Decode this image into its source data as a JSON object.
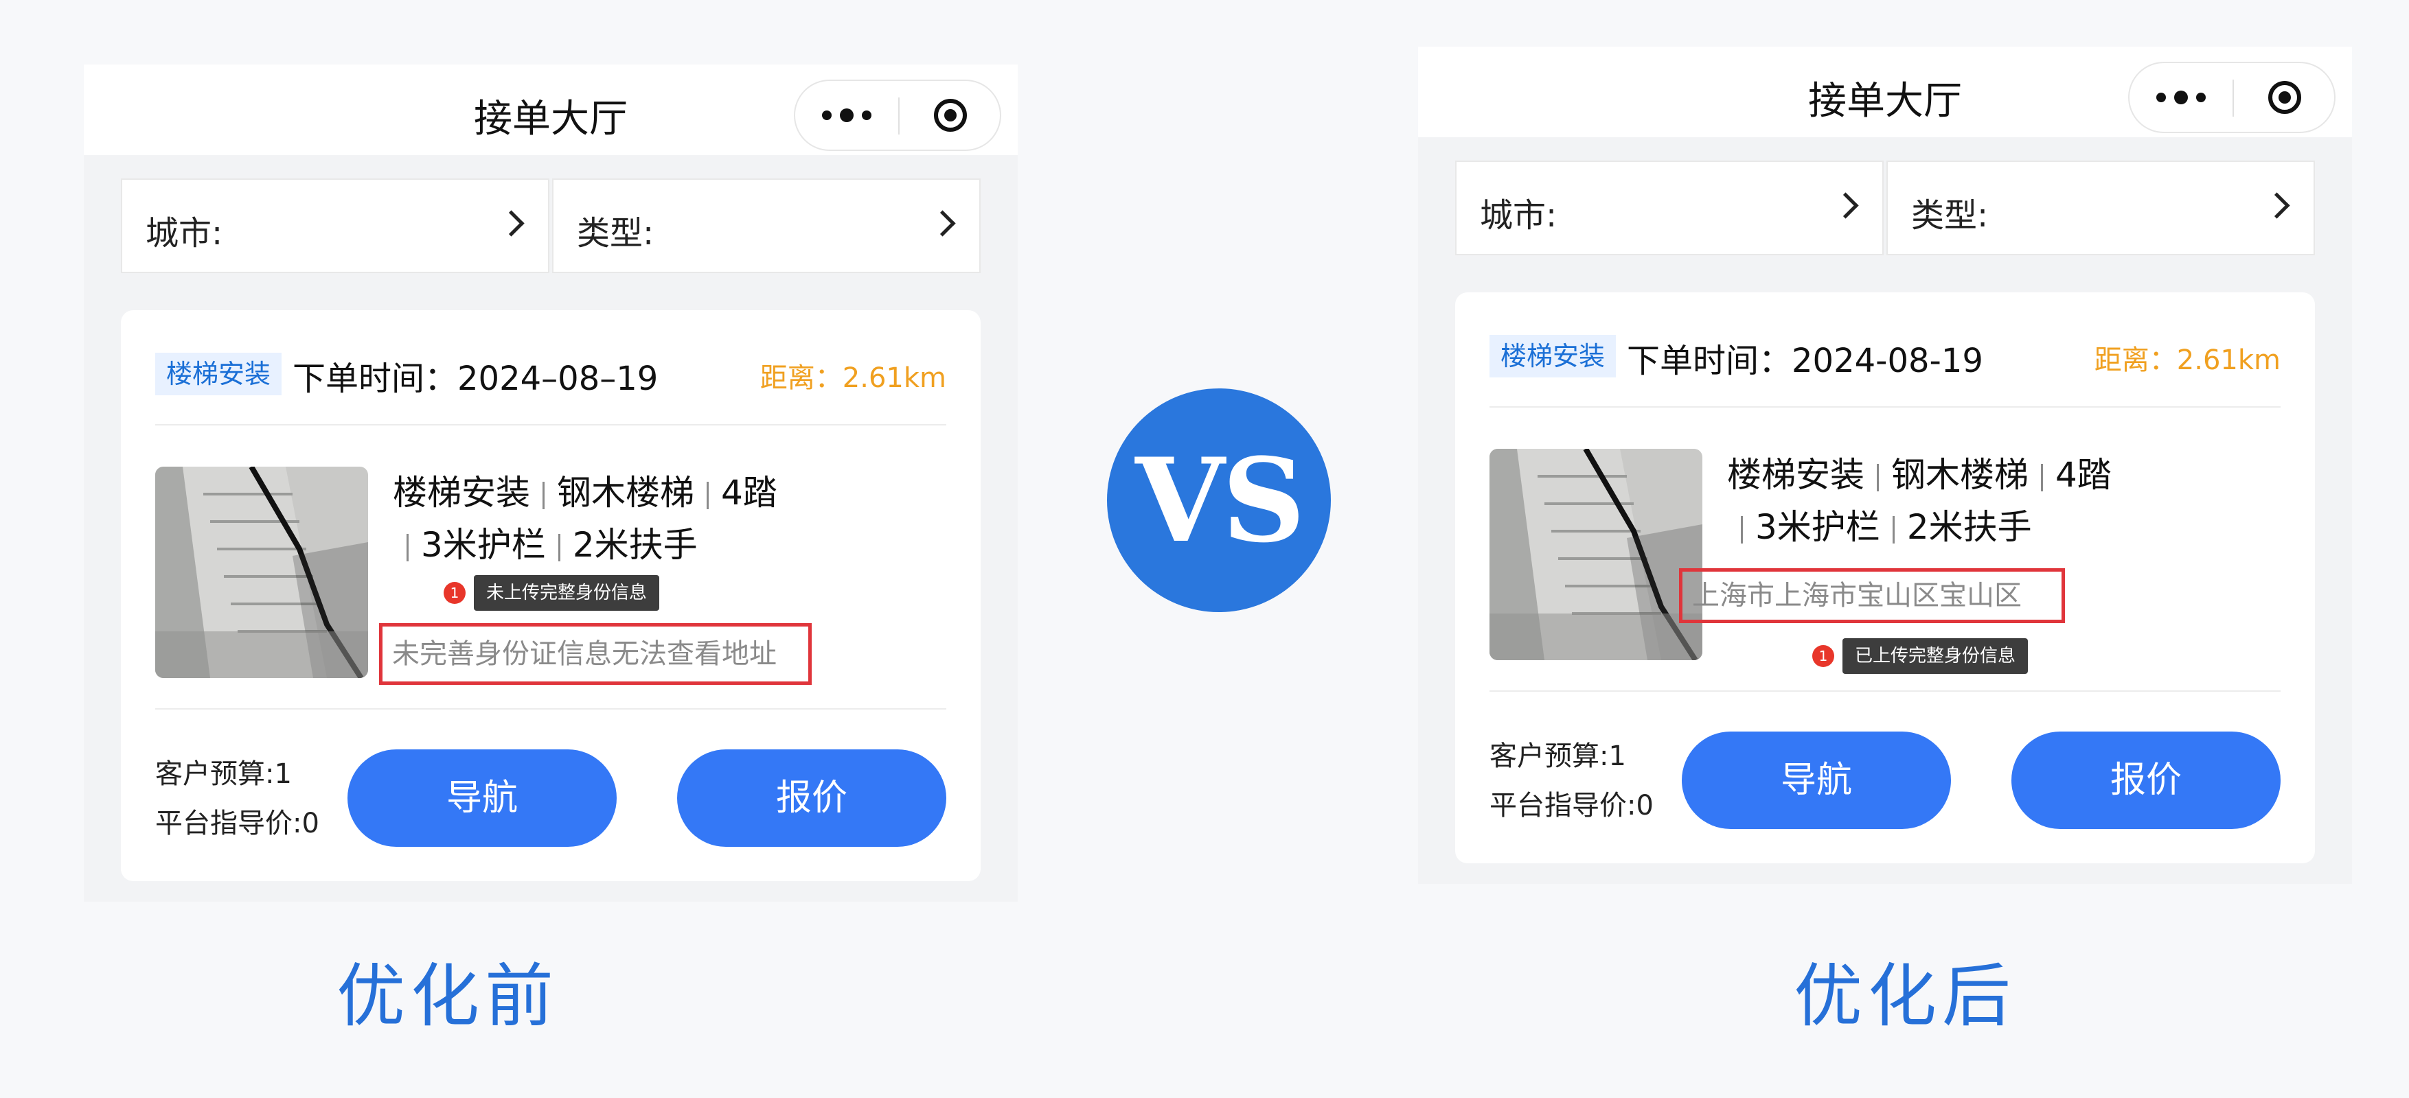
{
  "before": {
    "nav_title": "接单大厅",
    "filters": {
      "city_label": "城市:",
      "type_label": "类型:"
    },
    "card": {
      "type_tag": "楼梯安装",
      "order_time": "下单时间：2024–08–19",
      "distance": "距离：2.61km",
      "spec_items_line1": [
        "楼梯安装",
        "钢木楼梯",
        "4踏"
      ],
      "spec_items_line2": [
        "3米护栏",
        "2米扶手"
      ],
      "badge_count": "1",
      "tooltip": "未上传完整身份信息",
      "address_text": "未完善身份证信息无法查看地址",
      "budget": "客户预算:1",
      "guide_price": "平台指导价:0",
      "nav_button": "导航",
      "quote_button": "报价"
    },
    "caption": "优化前"
  },
  "after": {
    "nav_title": "接单大厅",
    "filters": {
      "city_label": "城市:",
      "type_label": "类型:"
    },
    "card": {
      "type_tag": "楼梯安装",
      "order_time": "下单时间：2024-08-19",
      "distance": "距离：2.61km",
      "spec_items_line1": [
        "楼梯安装",
        "钢木楼梯",
        "4踏"
      ],
      "spec_items_line2": [
        "3米护栏",
        "2米扶手"
      ],
      "badge_count": "1",
      "tooltip": "已上传完整身份信息",
      "address_text": "上海市上海市宝山区宝山区",
      "budget": "客户预算:1",
      "guide_price": "平台指导价:0",
      "nav_button": "导航",
      "quote_button": "报价"
    },
    "caption": "优化后"
  },
  "vs_label": "VS",
  "icons": {
    "capsule_menu": "more-dots-icon",
    "capsule_close": "target-icon",
    "filter_arrow": "chevron-right-icon"
  },
  "colors": {
    "primary": "#3478f6",
    "tag_bg": "#e8f1ff",
    "distance": "#f0a020",
    "highlight_border": "#e0353b",
    "badge": "#e8362a",
    "caption": "#2670d8"
  }
}
